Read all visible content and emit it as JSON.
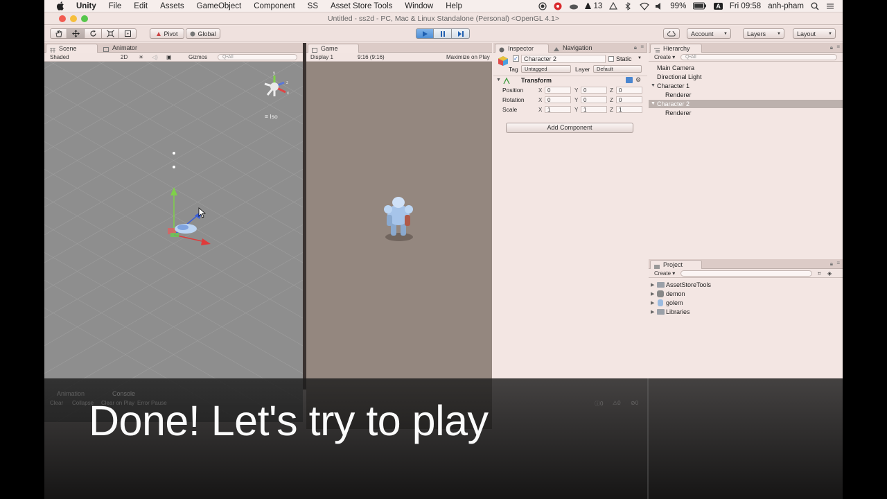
{
  "menubar": {
    "items": [
      "Unity",
      "File",
      "Edit",
      "Assets",
      "GameObject",
      "Component",
      "SS",
      "Asset Store Tools",
      "Window",
      "Help"
    ],
    "badge_count": "13",
    "battery": "99%",
    "input_source": "A",
    "clock": "Fri 09:58",
    "user": "anh-pham"
  },
  "window": {
    "title": "Untitled - ss2d - PC, Mac & Linux Standalone (Personal) <OpenGL 4.1>"
  },
  "toolbar": {
    "pivot": "Pivot",
    "global": "Global",
    "account": "Account",
    "layers": "Layers",
    "layout": "Layout"
  },
  "scene": {
    "tab": "Scene",
    "tab2": "Animator",
    "shading": "Shaded",
    "mode_2d": "2D",
    "gizmos": "Gizmos",
    "search_placeholder": "Q•All",
    "iso_label": "Iso"
  },
  "game": {
    "tab": "Game",
    "display": "Display 1",
    "aspect": "9:16 (9:16)",
    "maximize": "Maximize on Play"
  },
  "inspector": {
    "tab": "Inspector",
    "tab2": "Navigation",
    "object_name": "Character 2",
    "static_label": "Static",
    "tag_label": "Tag",
    "tag_value": "Untagged",
    "layer_label": "Layer",
    "layer_value": "Default",
    "component": "Transform",
    "rows": [
      {
        "label": "Position",
        "x": "0",
        "y": "0",
        "z": "0"
      },
      {
        "label": "Rotation",
        "x": "0",
        "y": "0",
        "z": "0"
      },
      {
        "label": "Scale",
        "x": "1",
        "y": "1",
        "z": "1"
      }
    ],
    "add_component": "Add Component"
  },
  "hierarchy": {
    "tab": "Hierarchy",
    "create": "Create",
    "search_placeholder": "Q•All",
    "items": [
      {
        "label": "Main Camera"
      },
      {
        "label": "Directional Light"
      },
      {
        "label": "Character 1"
      },
      {
        "label": "Renderer"
      },
      {
        "label": "Character 2"
      },
      {
        "label": "Renderer"
      }
    ]
  },
  "project": {
    "tab": "Project",
    "create": "Create",
    "items": [
      {
        "label": "AssetStoreTools"
      },
      {
        "label": "demon"
      },
      {
        "label": "golem"
      },
      {
        "label": "Libraries"
      }
    ]
  },
  "bottom_panel": {
    "tab1": "Animation",
    "tab2": "Console",
    "buttons": [
      "Clear",
      "Collapse",
      "Clear on Play",
      "Error Pause"
    ],
    "count1": "0",
    "count2": "0",
    "count3": "0"
  },
  "caption": "Done! Let's try to play"
}
